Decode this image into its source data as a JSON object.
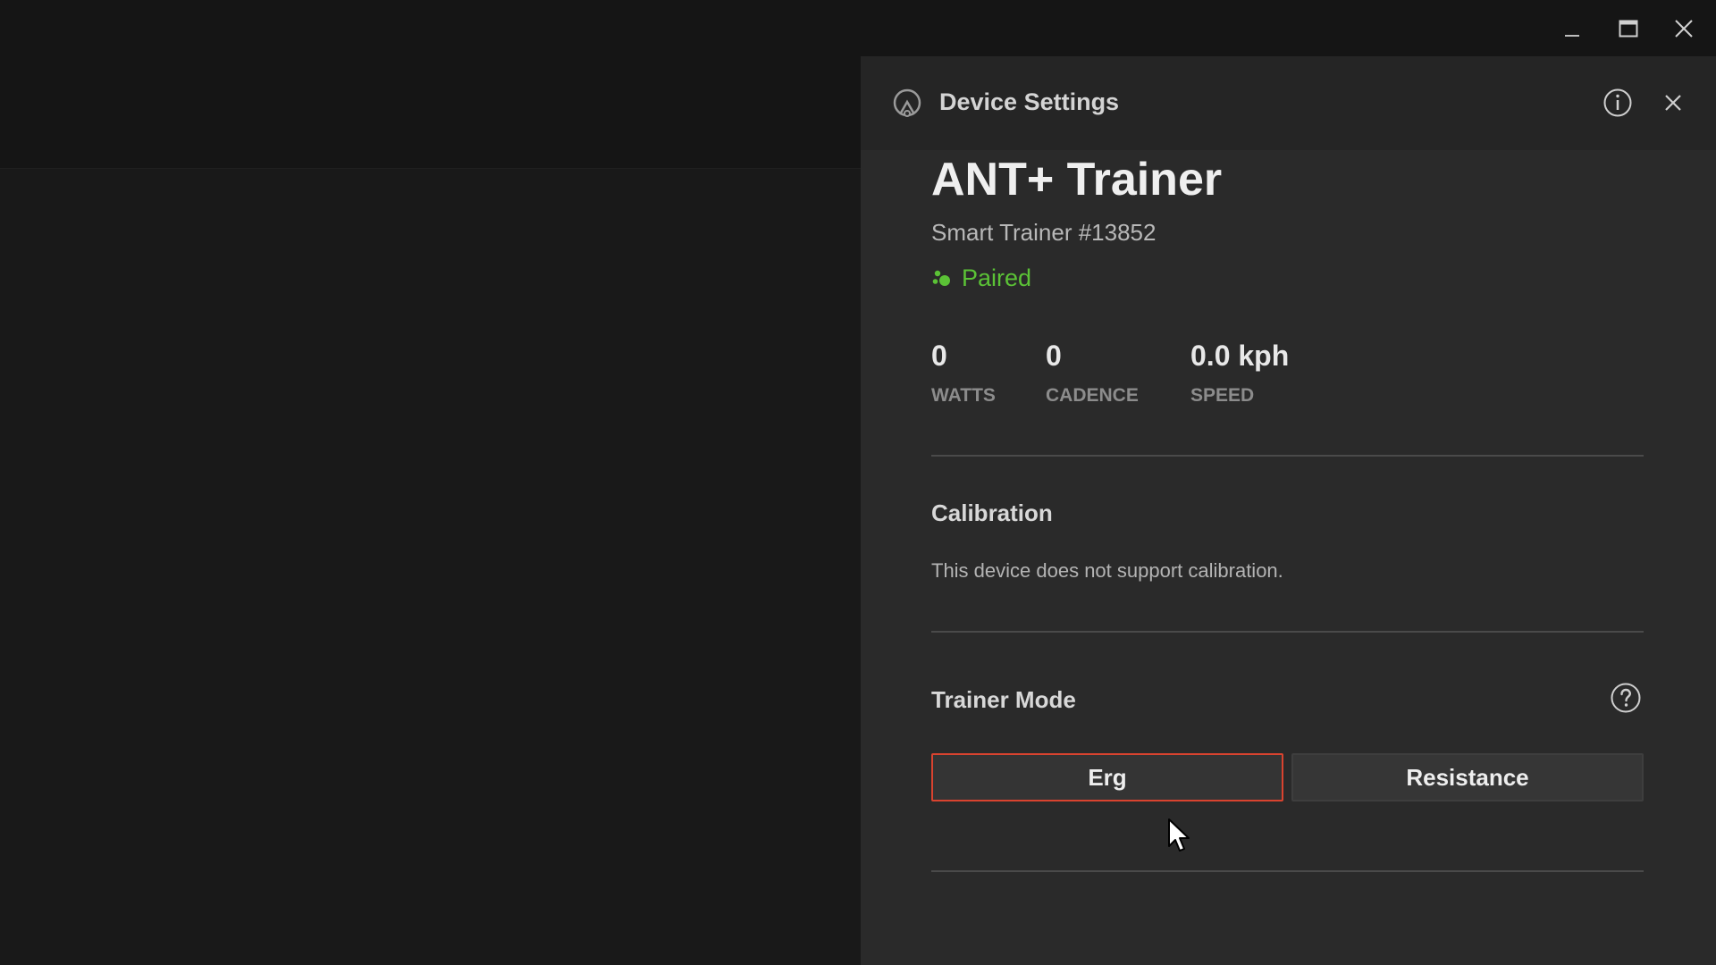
{
  "window": {
    "minimize_icon": "minimize-icon",
    "maximize_icon": "maximize-icon",
    "close_icon": "close-icon"
  },
  "panel": {
    "title": "Device Settings",
    "logo_icon": "device-logo-icon",
    "info_icon": "info-icon",
    "close_icon": "close-icon"
  },
  "device": {
    "name": "ANT+ Trainer",
    "subtitle": "Smart Trainer #13852",
    "status": "Paired",
    "status_color": "#5bc236"
  },
  "metrics": [
    {
      "value": "0",
      "label": "WATTS"
    },
    {
      "value": "0",
      "label": "CADENCE"
    },
    {
      "value": "0.0 kph",
      "label": "SPEED"
    }
  ],
  "calibration": {
    "title": "Calibration",
    "text": "This device does not support calibration."
  },
  "trainer_mode": {
    "title": "Trainer Mode",
    "help_icon": "help-icon",
    "options": [
      "Erg",
      "Resistance"
    ],
    "selected": "Erg",
    "accent": "#d9432f"
  }
}
